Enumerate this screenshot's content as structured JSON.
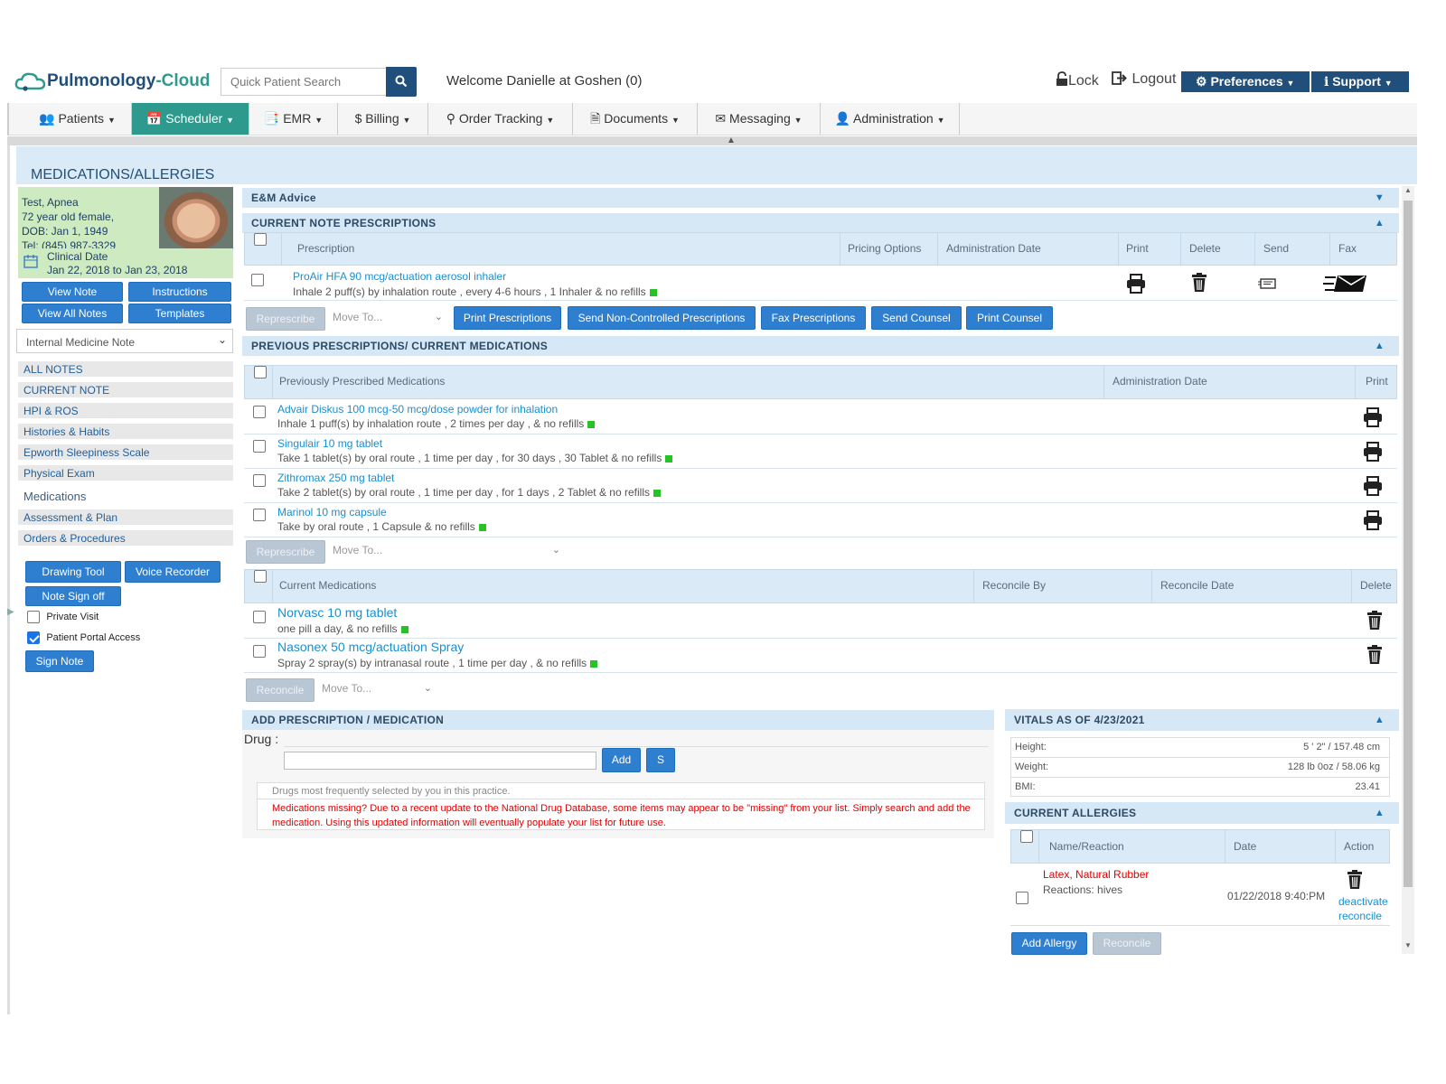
{
  "app": {
    "logo_text_1": "Pulmonology",
    "logo_text_sep": "-",
    "logo_text_2": "Cloud",
    "search_placeholder": "Quick Patient Search",
    "welcome": "Welcome Danielle at Goshen (0)",
    "lock": "Lock",
    "logout": "Logout",
    "preferences": "Preferences",
    "support": "Support"
  },
  "nav": {
    "items": [
      {
        "label": "Patients"
      },
      {
        "label": "Scheduler"
      },
      {
        "label": "EMR"
      },
      {
        "label": "Billing"
      },
      {
        "label": "Order Tracking"
      },
      {
        "label": "Documents"
      },
      {
        "label": "Messaging"
      },
      {
        "label": "Administration"
      }
    ]
  },
  "page_title": "MEDICATIONS/ALLERGIES",
  "patient": {
    "name": "Test, Apnea",
    "age_sex": "72 year old female,",
    "dob": "DOB: Jan 1, 1949",
    "tel": "Tel: (845) 987-3329",
    "clinical_label": "Clinical Date",
    "clinical_range": "Jan 22, 2018 to Jan 23, 2018"
  },
  "side_buttons": {
    "view_note": "View Note",
    "instructions": "Instructions",
    "view_all": "View All Notes",
    "templates": "Templates"
  },
  "note_type": "Internal Medicine Note",
  "side_menu": [
    {
      "label": "ALL NOTES"
    },
    {
      "label": "CURRENT NOTE"
    },
    {
      "label": "HPI & ROS"
    },
    {
      "label": "Histories & Habits"
    },
    {
      "label": "Epworth Sleepiness Scale"
    },
    {
      "label": "Physical Exam"
    },
    {
      "label": "Medications"
    },
    {
      "label": "Assessment & Plan"
    },
    {
      "label": "Orders & Procedures"
    }
  ],
  "tools": {
    "drawing": "Drawing Tool",
    "voice": "Voice Recorder",
    "signoff": "Note Sign off",
    "private": "Private Visit",
    "portal": "Patient Portal Access",
    "sign": "Sign Note"
  },
  "em_advice": "E&M Advice",
  "current_rx": {
    "title": "CURRENT NOTE PRESCRIPTIONS",
    "headers": [
      "Prescription",
      "Pricing Options",
      "Administration Date",
      "Print",
      "Delete",
      "Send",
      "Fax"
    ],
    "rows": [
      {
        "name": "ProAir HFA 90 mcg/actuation aerosol inhaler",
        "sig": "Inhale 2 puff(s) by inhalation route , every 4-6 hours , 1 Inhaler & no refills"
      }
    ],
    "represcribe": "Represcribe",
    "move_to": "Move To...",
    "print_rx": "Print Prescriptions",
    "send_noncontrolled": "Send Non-Controlled Prescriptions",
    "fax_rx": "Fax Prescriptions",
    "send_counsel": "Send Counsel",
    "print_counsel": "Print Counsel"
  },
  "previous": {
    "title": "PREVIOUS PRESCRIPTIONS/ CURRENT MEDICATIONS",
    "headers": [
      "Previously Prescribed Medications",
      "Administration Date",
      "Print"
    ],
    "rows": [
      {
        "name": "Advair Diskus 100 mcg-50 mcg/dose powder for inhalation",
        "sig": "Inhale 1 puff(s) by inhalation route , 2 times per day , & no refills"
      },
      {
        "name": "Singulair 10 mg tablet",
        "sig": "Take 1 tablet(s) by oral route , 1 time per day , for 30 days , 30 Tablet & no refills"
      },
      {
        "name": "Zithromax 250 mg tablet",
        "sig": "Take 2 tablet(s) by oral route , 1 time per day , for 1 days , 2 Tablet & no refills"
      },
      {
        "name": "Marinol 10 mg capsule",
        "sig": "Take by oral route , 1 Capsule & no refills"
      }
    ],
    "represcribe": "Represcribe",
    "move_to": "Move To..."
  },
  "current_meds": {
    "headers": [
      "Current Medications",
      "Reconcile By",
      "Reconcile Date",
      "Delete"
    ],
    "rows": [
      {
        "name": "Norvasc 10 mg tablet",
        "sig": "one pill a day, & no refills"
      },
      {
        "name": "Nasonex 50 mcg/actuation Spray",
        "sig": "Spray 2 spray(s) by intranasal route , 1 time per day , & no refills"
      }
    ],
    "reconcile": "Reconcile",
    "move_to": "Move To..."
  },
  "add_rx": {
    "title": "ADD PRESCRIPTION / MEDICATION",
    "drug_label": "Drug :",
    "add": "Add",
    "s": "S",
    "frequent": "Drugs most frequently selected by you in this practice.",
    "warning": "Medications missing? Due to a recent update to the National Drug Database, some items may appear to be \"missing\" from your list. Simply search and add the medication. Using this updated information will eventually populate your list for future use."
  },
  "vitals": {
    "title": "VITALS AS OF 4/23/2021",
    "rows": [
      {
        "label": "Height:",
        "value": "5 ' 2\" / 157.48 cm"
      },
      {
        "label": "Weight:",
        "value": "128 lb 0oz / 58.06 kg"
      },
      {
        "label": "BMI:",
        "value": "23.41"
      }
    ]
  },
  "allergies": {
    "title": "CURRENT ALLERGIES",
    "headers": [
      "Name/Reaction",
      "Date",
      "Action"
    ],
    "rows": [
      {
        "name": "Latex, Natural Rubber",
        "reaction": "Reactions: hives",
        "date": "01/22/2018 9:40:PM",
        "deactivate": "deactivate",
        "reconcile": "reconcile"
      }
    ],
    "add": "Add Allergy",
    "reconcile": "Reconcile"
  },
  "colors": {
    "accent": "#2f7fd0",
    "section_bar": "#d6e7f5",
    "nav_active": "#2e9a8e",
    "warning_text": "#e00000",
    "e_badge": "#26c226"
  }
}
